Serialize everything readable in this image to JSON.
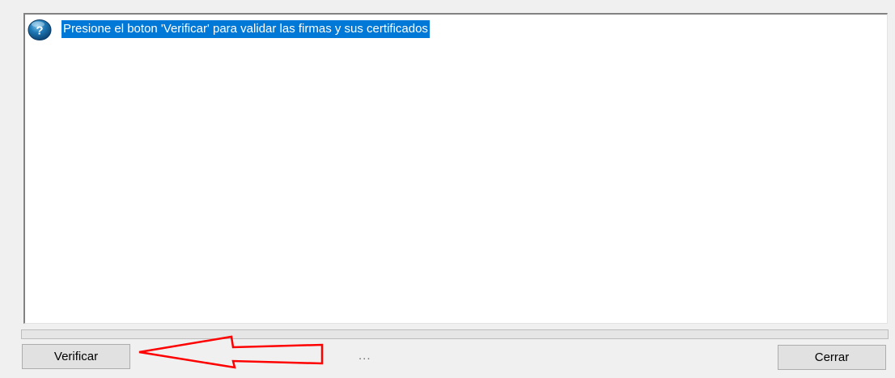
{
  "listbox": {
    "items": [
      {
        "icon": "question-info-icon",
        "text": "Presione el boton 'Verificar' para validar las firmas y sus certificados",
        "selected": true
      }
    ]
  },
  "progress": {
    "value": 0
  },
  "buttons": {
    "verify_label": "Verificar",
    "close_label": "Cerrar"
  },
  "status": {
    "text": "..."
  },
  "annotation": {
    "arrow_color": "#ff0000",
    "points_to": "verify-button"
  },
  "colors": {
    "selection": "#0078d7",
    "window_bg": "#f0f0f0"
  }
}
